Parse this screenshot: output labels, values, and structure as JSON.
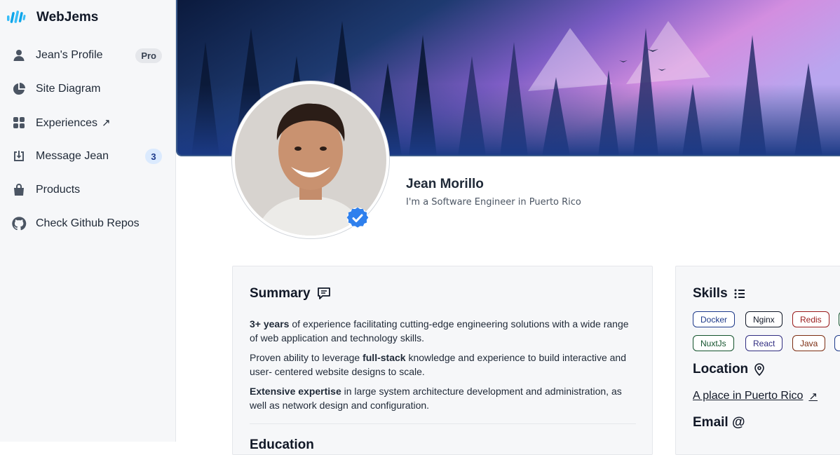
{
  "brand": {
    "name": "WebJems"
  },
  "sidebar": {
    "items": [
      {
        "label": "Jean's Profile",
        "icon": "user-icon",
        "badge": "Pro"
      },
      {
        "label": "Site Diagram",
        "icon": "pie-chart-icon"
      },
      {
        "label": "Experiences",
        "icon": "grid-icon",
        "external": "↗"
      },
      {
        "label": "Message Jean",
        "icon": "inbox-download-icon",
        "count": "3"
      },
      {
        "label": "Products",
        "icon": "shopping-bag-icon"
      },
      {
        "label": "Check Github Repos",
        "icon": "github-icon"
      }
    ]
  },
  "profile": {
    "name": "Jean Morillo",
    "tagline": "I'm a Software Engineer in Puerto Rico"
  },
  "summary": {
    "title": "Summary",
    "p1_bold": "3+ years",
    "p1_rest": " of experience facilitating cutting-edge engineering solutions with a wide range of web application and technology skills.",
    "p2_pre": "Proven ability to leverage ",
    "p2_bold": "full-stack",
    "p2_rest": " knowledge and experience to build interactive and user- centered website designs to scale.",
    "p3_bold": "Extensive expertise",
    "p3_rest": " in large system architecture development and administration, as well as network design and configuration.",
    "next_title": "Education"
  },
  "skills": {
    "title": "Skills",
    "chips": [
      {
        "label": "Docker",
        "color": "#1e3a8a"
      },
      {
        "label": "Nginx",
        "color": "#111827"
      },
      {
        "label": "Redis",
        "color": "#991b1b"
      },
      {
        "label": "NuxtJs",
        "color": "#14532d"
      },
      {
        "label": "React",
        "color": "#312e81"
      },
      {
        "label": "Java",
        "color": "#7c2d12"
      }
    ]
  },
  "location": {
    "title": "Location",
    "link": "A place in Puerto Rico",
    "arrow": "↗"
  },
  "email": {
    "title": "Email @"
  },
  "colors": {
    "accent": "#2563eb",
    "sidebar_bg": "#f6f7f9",
    "card_bg": "#f6f7f9"
  }
}
